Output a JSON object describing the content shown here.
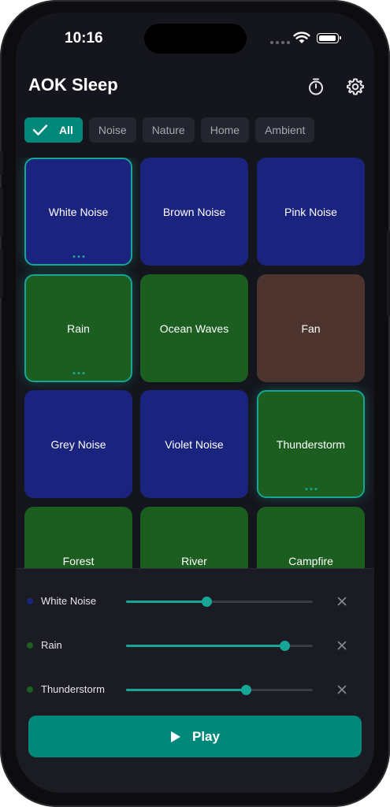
{
  "status_bar": {
    "time": "10:16"
  },
  "header": {
    "title": "AOK Sleep",
    "timer_icon": "timer-icon",
    "settings_icon": "gear-icon"
  },
  "filters": [
    {
      "label": "All",
      "active": true
    },
    {
      "label": "Noise",
      "active": false
    },
    {
      "label": "Nature",
      "active": false
    },
    {
      "label": "Home",
      "active": false
    },
    {
      "label": "Ambient",
      "active": false
    }
  ],
  "colors": {
    "accent": "#00897b",
    "noise_tile": "#1a237e",
    "nature_tile": "#1b5e20",
    "home_tile": "#4e342e"
  },
  "sounds": [
    {
      "label": "White Noise",
      "category": "noise",
      "selected": true
    },
    {
      "label": "Brown Noise",
      "category": "noise",
      "selected": false
    },
    {
      "label": "Pink Noise",
      "category": "noise",
      "selected": false
    },
    {
      "label": "Rain",
      "category": "nature",
      "selected": true
    },
    {
      "label": "Ocean Waves",
      "category": "nature",
      "selected": false
    },
    {
      "label": "Fan",
      "category": "home",
      "selected": false
    },
    {
      "label": "Grey Noise",
      "category": "noise",
      "selected": false
    },
    {
      "label": "Violet Noise",
      "category": "noise",
      "selected": false
    },
    {
      "label": "Thunderstorm",
      "category": "nature",
      "selected": true
    },
    {
      "label": "Forest",
      "category": "nature",
      "selected": false
    },
    {
      "label": "River",
      "category": "nature",
      "selected": false
    },
    {
      "label": "Campfire",
      "category": "nature",
      "selected": false
    }
  ],
  "mixer": [
    {
      "label": "White Noise",
      "dot_color": "#1a237e",
      "volume": 0.43
    },
    {
      "label": "Rain",
      "dot_color": "#1b5e20",
      "volume": 0.85
    },
    {
      "label": "Thunderstorm",
      "dot_color": "#1b5e20",
      "volume": 0.64
    }
  ],
  "play_button": {
    "label": "Play",
    "icon": "play-icon"
  }
}
